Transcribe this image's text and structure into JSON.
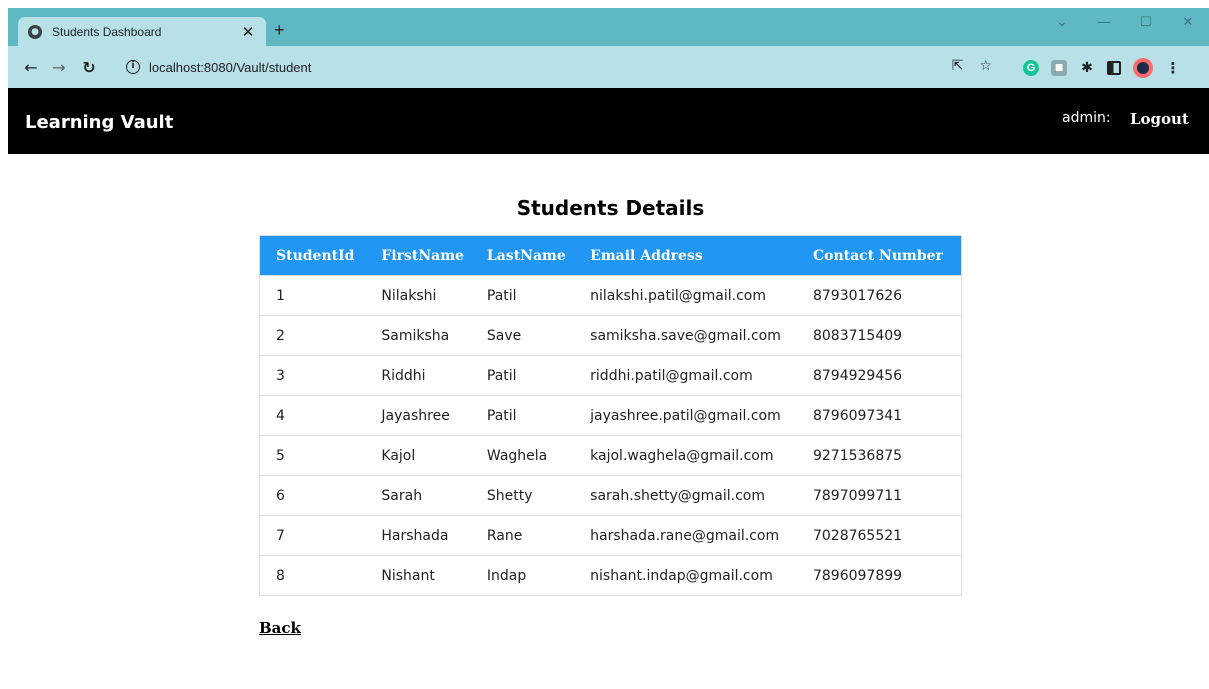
{
  "browser": {
    "tab_title": "Students Dashboard",
    "url": "localhost:8080/Vault/student",
    "theme_color": "#5fb9c5"
  },
  "header": {
    "brand": "Learning Vault",
    "user_label": "admin:",
    "logout_label": "Logout",
    "background": "#000000"
  },
  "main": {
    "title": "Students Details",
    "table": {
      "header_color": "#2196f3",
      "columns": [
        "StudentId",
        "FirstName",
        "LastName",
        "Email Address",
        "Contact Number"
      ],
      "rows": [
        [
          "1",
          "Nilakshi",
          "Patil",
          "nilakshi.patil@gmail.com",
          "8793017626"
        ],
        [
          "2",
          "Samiksha",
          "Save",
          "samiksha.save@gmail.com",
          "8083715409"
        ],
        [
          "3",
          "Riddhi",
          "Patil",
          "riddhi.patil@gmail.com",
          "8794929456"
        ],
        [
          "4",
          "Jayashree",
          "Patil",
          "jayashree.patil@gmail.com",
          "8796097341"
        ],
        [
          "5",
          "Kajol",
          "Waghela",
          "kajol.waghela@gmail.com",
          "9271536875"
        ],
        [
          "6",
          "Sarah",
          "Shetty",
          "sarah.shetty@gmail.com",
          "7897099711"
        ],
        [
          "7",
          "Harshada",
          "Rane",
          "harshada.rane@gmail.com",
          "7028765521"
        ],
        [
          "8",
          "Nishant",
          "Indap",
          "nishant.indap@gmail.com",
          "7896097899"
        ]
      ]
    },
    "back_label": "Back"
  }
}
